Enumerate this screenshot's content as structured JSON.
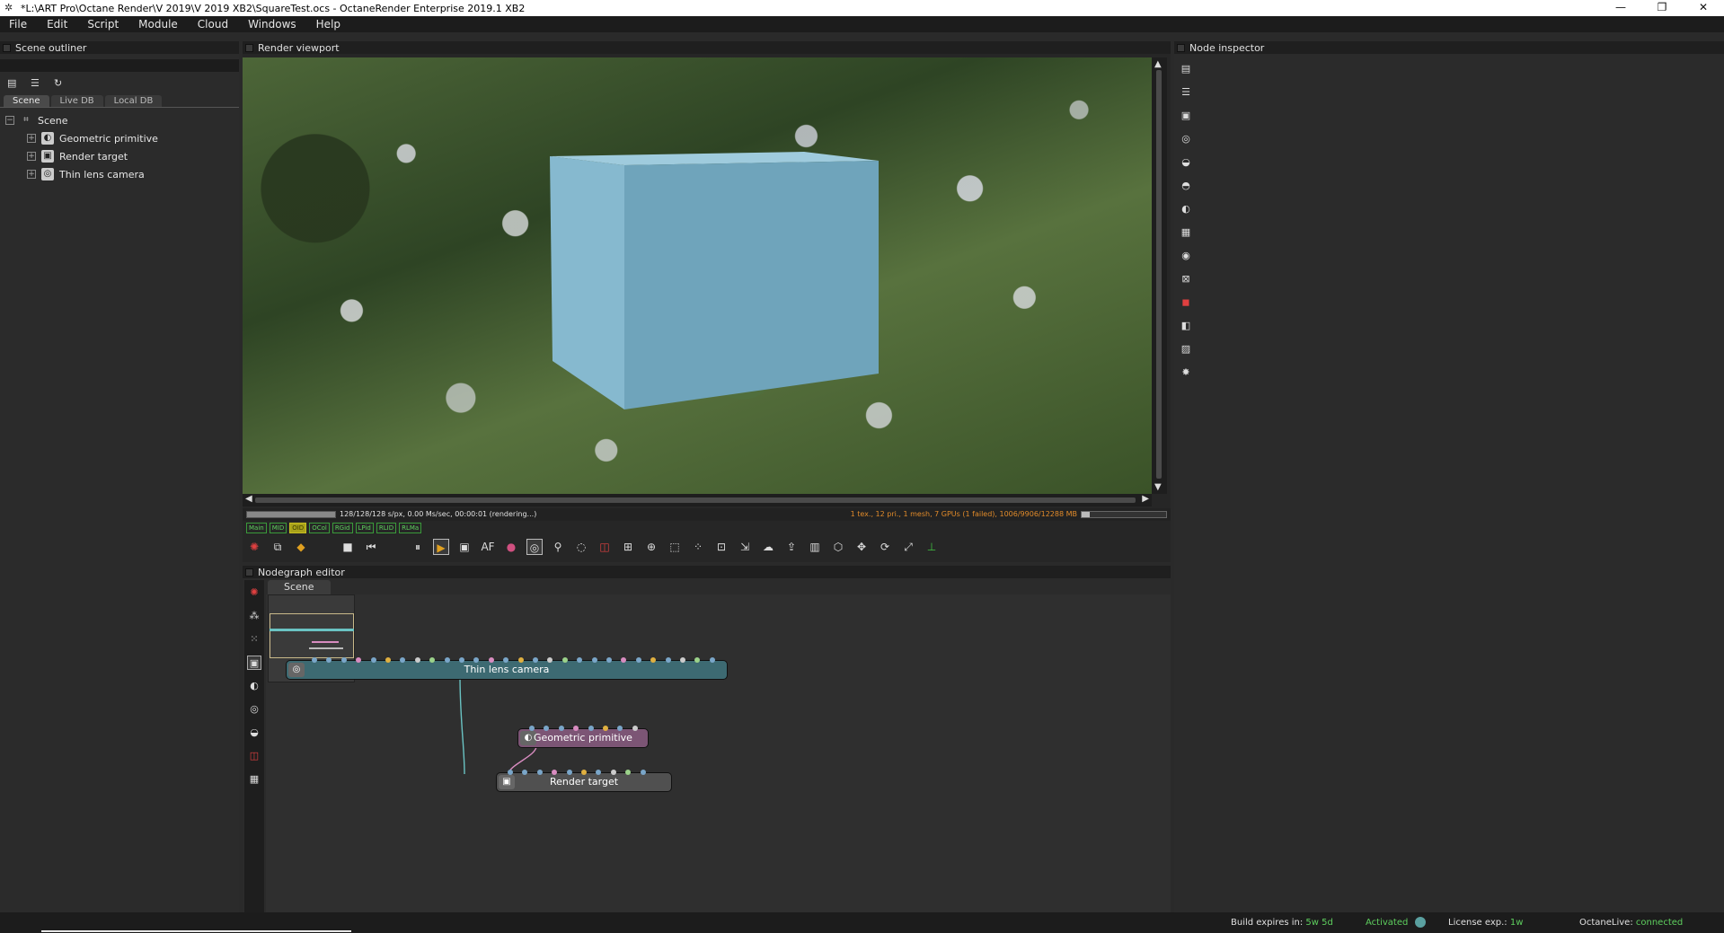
{
  "window": {
    "title": "*L:\\ART Pro\\Octane Render\\V 2019\\V 2019 XB2\\SquareTest.ocs - OctaneRender Enterprise 2019.1 XB2",
    "controls": [
      "—",
      "❐",
      "✕"
    ]
  },
  "menu": [
    "File",
    "Edit",
    "Script",
    "Module",
    "Cloud",
    "Windows",
    "Help"
  ],
  "outliner": {
    "title": "Scene outliner",
    "tabs": [
      "Scene",
      "Live DB",
      "Local DB"
    ],
    "active_tab": "Scene",
    "tree": {
      "root": "Scene",
      "items": [
        "Geometric primitive",
        "Render target",
        "Thin lens camera"
      ]
    }
  },
  "viewport": {
    "title": "Render viewport",
    "status_left": "128/128/128 s/px, 0.00 Ms/sec, 00:00:01 (rendering...)",
    "status_right": "1 tex., 12 pri., 1 mesh, 7 GPUs (1 failed), 1006/9906/12288 MB",
    "memory_fraction": 0.1,
    "passes": [
      "Main",
      "MID",
      "OID",
      "OCol",
      "RGid",
      "LPid",
      "RLID",
      "RLMa"
    ],
    "active_pass": "OID",
    "cube_color": "#7fb3cc"
  },
  "inspector": {
    "title": "Node inspector"
  },
  "nodegraph": {
    "title": "Nodegraph editor",
    "tab": "Scene",
    "nodes": {
      "camera": "Thin lens camera",
      "geometry": "Geometric primitive",
      "render_target": "Render target"
    }
  },
  "footer": {
    "build_label": "Build expires in:",
    "build_value": "5w 5d",
    "activated": "Activated",
    "license_label": "License exp.:",
    "license_value": "1w",
    "live_label": "OctaneLive:",
    "live_value": "connected"
  }
}
